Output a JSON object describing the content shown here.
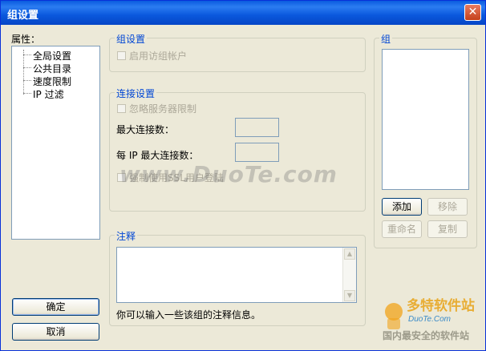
{
  "window": {
    "title": "组设置",
    "close_glyph": "✕"
  },
  "properties": {
    "label": "属性：",
    "tree_items": [
      "全局设置",
      "公共目录",
      "速度限制",
      "IP 过滤"
    ]
  },
  "group_settings": {
    "title": "组设置",
    "enable_group_account": "启用访组帐户"
  },
  "connection_settings": {
    "title": "连接设置",
    "ignore_server_limit": "忽略服务器限制",
    "max_connections_label": "最大连接数：",
    "max_connections_value": "",
    "max_per_ip_label": "每 IP 最大连接数：",
    "max_per_ip_value": "",
    "force_ssl_login": "强制使用SSL用户登陆"
  },
  "notes": {
    "title": "注释",
    "value": "",
    "hint": "你可以输入一些该组的注释信息。"
  },
  "groups_panel": {
    "title": "组",
    "add_label": "添加",
    "remove_label": "移除",
    "rename_label": "重命名",
    "copy_label": "复制"
  },
  "buttons": {
    "ok_label": "确定",
    "cancel_label": "取消"
  },
  "watermarks": {
    "center_text": "www.DuoTe.com",
    "logo_text": "多特软件站",
    "logo_url": "DuoTe.Com",
    "logo_slogan": "国内最安全的软件站"
  },
  "colors": {
    "titlebar": "#0a5bdf",
    "dialog_bg": "#ece9d8",
    "group_title": "#0046d5",
    "disabled_text": "#aca899"
  }
}
